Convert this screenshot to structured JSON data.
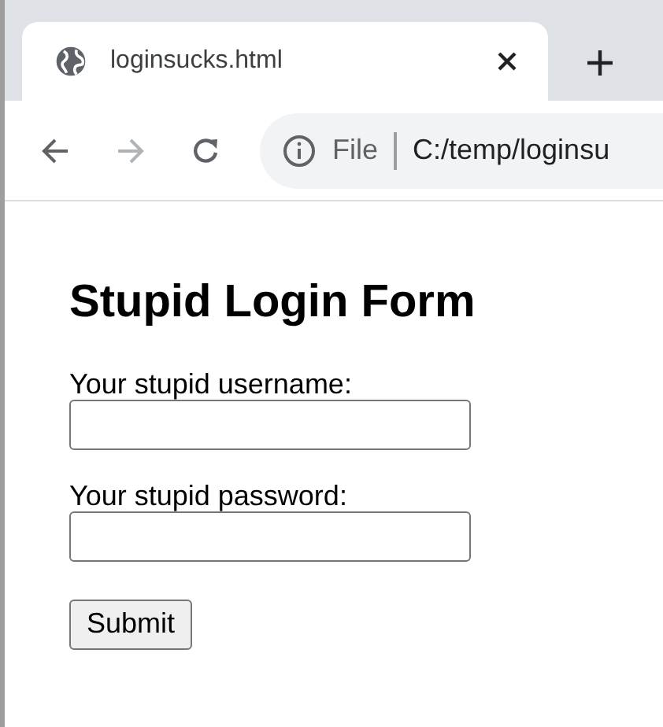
{
  "tab": {
    "title": "loginsucks.html",
    "selected": true
  },
  "address_bar": {
    "scheme": "File",
    "url": "C:/temp/loginsu"
  },
  "nav": {
    "back_disabled": false,
    "forward_disabled": true
  },
  "page": {
    "heading": "Stupid Login Form",
    "fields": [
      {
        "label": "Your stupid username:"
      },
      {
        "label": "Your stupid password:"
      }
    ],
    "submit": "Submit"
  }
}
